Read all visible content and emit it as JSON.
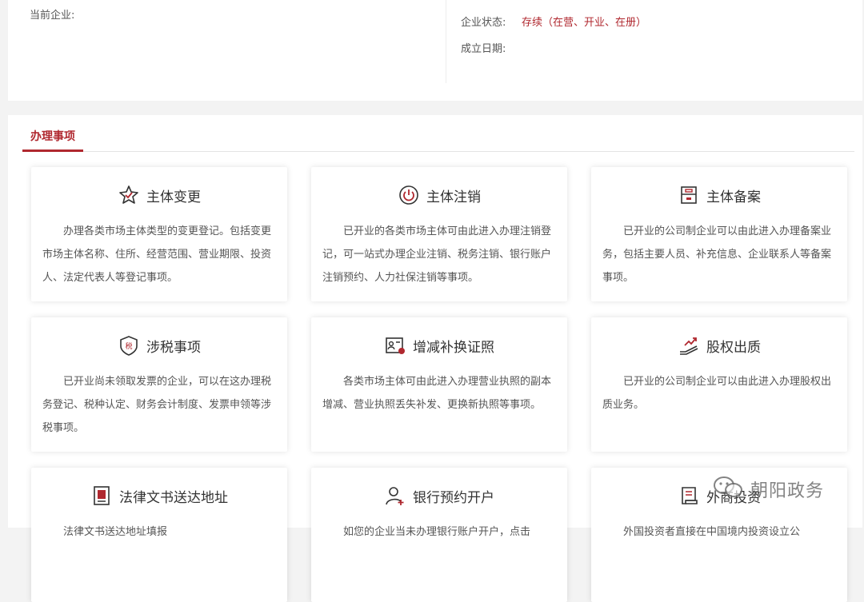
{
  "company_info": {
    "current_company_label": "当前企业:",
    "status_label": "企业状态:",
    "status_value": "存续（在营、开业、在册）",
    "founded_label": "成立日期:"
  },
  "section": {
    "tab_label": "办理事项"
  },
  "cards": [
    {
      "title": "主体变更",
      "icon": "star-badge-icon",
      "desc": "办理各类市场主体类型的变更登记。包括变更市场主体名称、住所、经营范围、营业期限、投资人、法定代表人等登记事项。"
    },
    {
      "title": "主体注销",
      "icon": "power-icon",
      "desc": "已开业的各类市场主体可由此进入办理注销登记，可一站式办理企业注销、税务注销、银行账户注销预约、人力社保注销等事项。"
    },
    {
      "title": "主体备案",
      "icon": "record-box-icon",
      "desc": "已开业的公司制企业可以由此进入办理备案业务，包括主要人员、补充信息、企业联系人等备案事项。"
    },
    {
      "title": "涉税事项",
      "icon": "tax-shield-icon",
      "desc": "已开业尚未领取发票的企业，可以在这办理税务登记、税种认定、财务会计制度、发票申领等涉税事项。"
    },
    {
      "title": "增减补换证照",
      "icon": "license-card-icon",
      "desc": "各类市场主体可由此进入办理营业执照的副本增减、营业执照丢失补发、更换新执照等事项。"
    },
    {
      "title": "股权出质",
      "icon": "equity-hand-icon",
      "desc": "已开业的公司制企业可以由此进入办理股权出质业务。"
    },
    {
      "title": "法律文书送达地址",
      "icon": "legal-document-icon",
      "desc": "法律文书送达地址填报"
    },
    {
      "title": "银行预约开户",
      "icon": "user-plus-icon",
      "desc": "如您的企业当未办理银行账户开户，点击"
    },
    {
      "title": "外商投资",
      "icon": "scroll-document-icon",
      "desc": "外国投资者直接在中国境内投资设立公"
    }
  ],
  "watermark": {
    "text": "朝阳政务"
  },
  "colors": {
    "accent": "#b0282f",
    "text": "#333333"
  }
}
